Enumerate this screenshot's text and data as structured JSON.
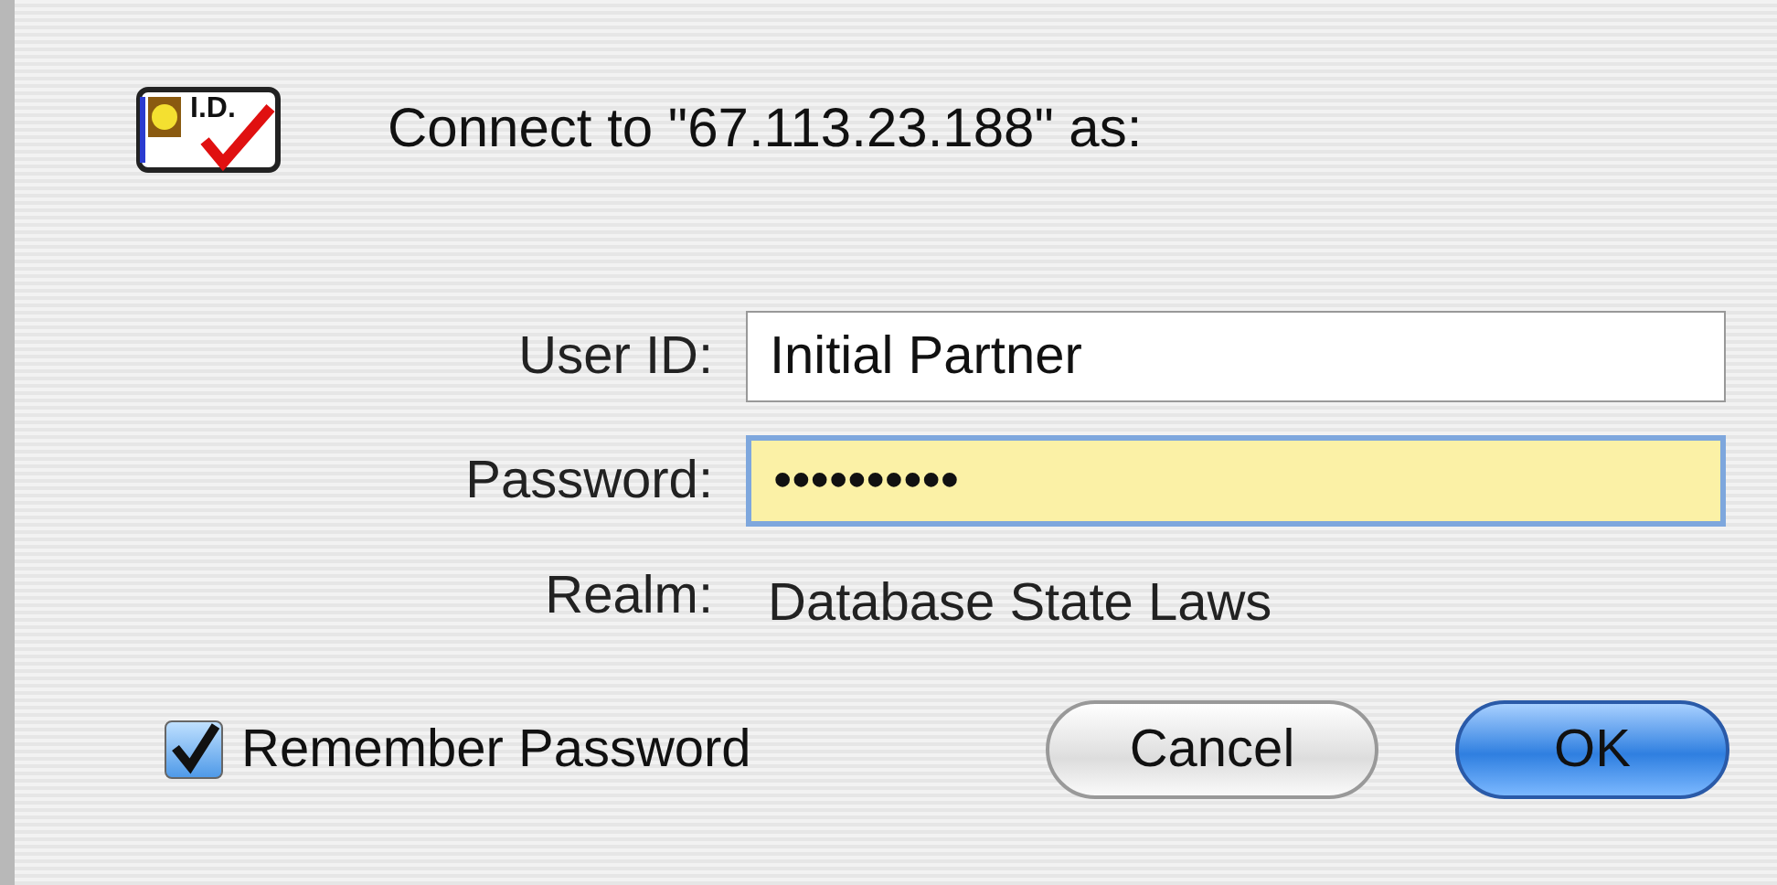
{
  "dialog": {
    "icon_label": "I.D.",
    "title": "Connect to \"67.113.23.188\" as:"
  },
  "fields": [
    {
      "label": "User ID:",
      "value": "Initial Partner",
      "focused": false
    },
    {
      "label": "Password:",
      "value": "••••••••••",
      "focused": true
    }
  ],
  "realm": {
    "label": "Realm:",
    "value": "Database State Laws"
  },
  "remember": {
    "label": "Remember Password",
    "checked": true
  },
  "buttons": [
    {
      "label": "Cancel",
      "kind": "secondary"
    },
    {
      "label": "OK",
      "kind": "default"
    }
  ]
}
